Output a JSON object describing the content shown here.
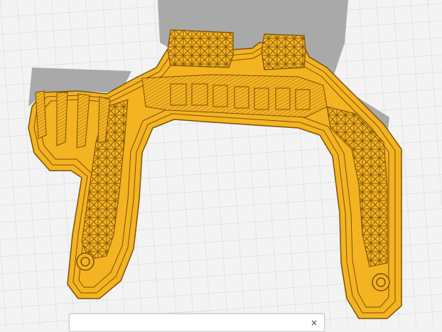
{
  "app": {
    "view": "layer preview",
    "colors": {
      "background": "#f3f3f3",
      "grid_line": "#d4d4d4",
      "shadow": "#a9a9a9",
      "print_fill": "#f4b321",
      "print_line": "#7a5207",
      "infill_line": "#8a5c0a"
    }
  },
  "panel": {
    "title": "",
    "close_icon": "close-icon"
  }
}
